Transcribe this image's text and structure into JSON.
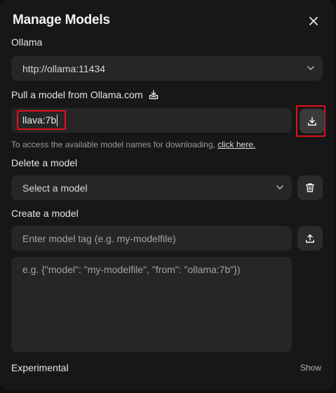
{
  "modal": {
    "title": "Manage Models",
    "close_icon": "close-icon"
  },
  "ollama": {
    "section_label": "Ollama",
    "url": "http://ollama:11434"
  },
  "pull": {
    "label": "Pull a model from Ollama.com",
    "input_value": "llava:7b",
    "hint_text": "To access the available model names for downloading,",
    "hint_link": "click here."
  },
  "delete": {
    "label": "Delete a model",
    "select_placeholder": "Select a model"
  },
  "create": {
    "label": "Create a model",
    "tag_placeholder": "Enter model tag (e.g. my-modelfile)",
    "content_placeholder": "e.g. {\"model\": \"my-modelfile\", \"from\": \"ollama:7b\"})"
  },
  "experimental": {
    "label": "Experimental",
    "toggle_label": "Show"
  },
  "colors": {
    "background": "#171717",
    "field": "#262626",
    "highlight": "#e0131a"
  }
}
